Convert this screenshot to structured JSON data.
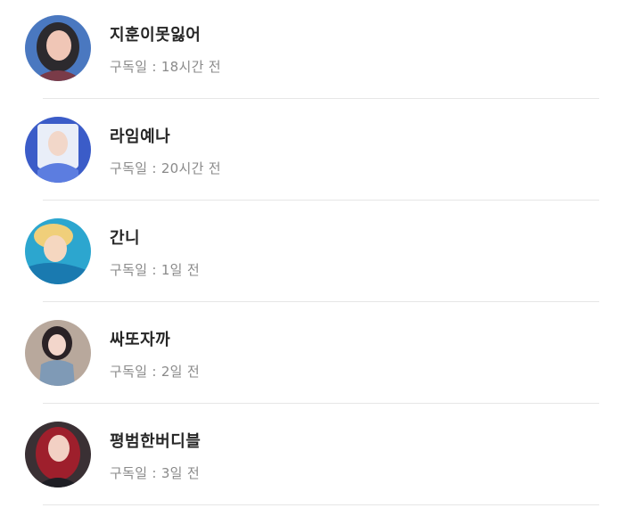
{
  "subscribers": [
    {
      "name": "지훈이못잃어",
      "subscribed_label": "구독일",
      "subscribed_value": "18시간 전",
      "avatar_colors": [
        "#4a78c0",
        "#2c2a2e",
        "#f0c6b6",
        "#7a3b48"
      ]
    },
    {
      "name": "라임예나",
      "subscribed_label": "구독일",
      "subscribed_value": "20시간 전",
      "avatar_colors": [
        "#3b5cc8",
        "#e9eef8",
        "#f2d7c9",
        "#5c7de0"
      ]
    },
    {
      "name": "간니",
      "subscribed_label": "구독일",
      "subscribed_value": "1일 전",
      "avatar_colors": [
        "#2ca6cf",
        "#f0cf7a",
        "#f5d7c0",
        "#1a7ab0"
      ]
    },
    {
      "name": "싸또자까",
      "subscribed_label": "구독일",
      "subscribed_value": "2일 전",
      "avatar_colors": [
        "#b8a89c",
        "#2a2226",
        "#f3d6cb",
        "#7f9ab6"
      ]
    },
    {
      "name": "평범한버디블",
      "subscribed_label": "구독일",
      "subscribed_value": "3일 전",
      "avatar_colors": [
        "#3a3034",
        "#9e1f2c",
        "#f2d0c4",
        "#1e1e24"
      ]
    }
  ],
  "separator": " : "
}
